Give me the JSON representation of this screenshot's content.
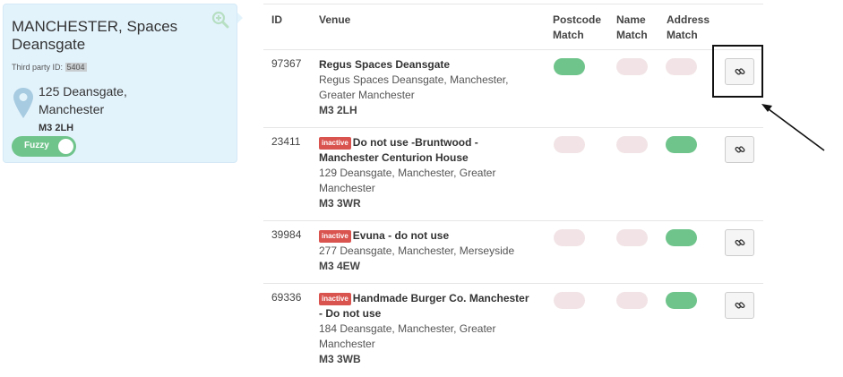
{
  "card": {
    "title": "MANCHESTER, Spaces Deansgate",
    "third_party_label": "Third party ID:",
    "third_party_id": "5404",
    "address_line1": "125 Deansgate,",
    "address_line2": "Manchester",
    "postcode": "M3 2LH",
    "toggle_label": "Fuzzy",
    "toggle_on": true,
    "zoom_icon": "zoom-in-icon",
    "pin_icon": "map-pin-icon"
  },
  "table": {
    "headers": {
      "id": "ID",
      "venue": "Venue",
      "postcode_match_1": "Postcode",
      "postcode_match_2": "Match",
      "name_match_1": "Name",
      "name_match_2": "Match",
      "address_match_1": "Address",
      "address_match_2": "Match"
    },
    "rows": [
      {
        "id": "97367",
        "badge": "",
        "name_line1": "Regus Spaces Deansgate",
        "name_line2": "",
        "address_line1": "Regus Spaces Deansgate, Manchester,",
        "address_line2": "Greater Manchester",
        "postcode": "M3 2LH",
        "postcode_match": true,
        "name_match": false,
        "address_match": false
      },
      {
        "id": "23411",
        "badge": "inactive",
        "name_line1": "Do not use -Bruntwood -",
        "name_line2": "Manchester Centurion House",
        "address_line1": "129 Deansgate, Manchester, Greater",
        "address_line2": "Manchester",
        "postcode": "M3 3WR",
        "postcode_match": false,
        "name_match": false,
        "address_match": true
      },
      {
        "id": "39984",
        "badge": "inactive",
        "name_line1": "Evuna - do not use",
        "name_line2": "",
        "address_line1": "277 Deansgate, Manchester, Merseyside",
        "address_line2": "",
        "postcode": "M3 4EW",
        "postcode_match": false,
        "name_match": false,
        "address_match": true
      },
      {
        "id": "69336",
        "badge": "inactive",
        "name_line1": "Handmade Burger Co. Manchester",
        "name_line2": "- Do not use",
        "address_line1": "184 Deansgate, Manchester, Greater",
        "address_line2": "Manchester",
        "postcode": "M3 3WB",
        "postcode_match": false,
        "name_match": false,
        "address_match": true
      }
    ],
    "link_icon": "link-icon"
  },
  "colors": {
    "match_on": "#6fc48b",
    "match_off": "#f2e4e6",
    "badge_bg": "#d9534f",
    "card_bg": "#e3f3fc"
  }
}
